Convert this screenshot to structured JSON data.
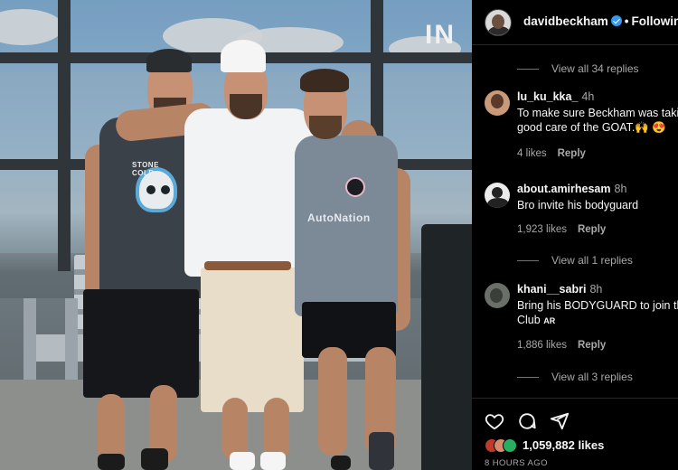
{
  "post": {
    "photo_sponsor": "AutoNation",
    "photo_shirt_text": "STONE COLD",
    "photo_building_text": "IN"
  },
  "header": {
    "username": "davidbeckham",
    "separator": "•",
    "follow_label": "Following"
  },
  "comments": [
    {
      "type": "view_replies",
      "label": "View all 34 replies"
    },
    {
      "type": "comment",
      "user": "lu_ku_kka_",
      "time": "4h",
      "text_line1": "To make sure Beckham was takin",
      "text_line2": "good care of the GOAT.🙌 😍",
      "likes": "4 likes",
      "reply": "Reply"
    },
    {
      "type": "comment",
      "user": "about.amirhesam",
      "time": "8h",
      "text_line1": "Bro invite his bodyguard",
      "likes": "1,923 likes",
      "reply": "Reply"
    },
    {
      "type": "view_replies",
      "label": "View all 1 replies"
    },
    {
      "type": "comment",
      "user": "khani__sabri",
      "time": "8h",
      "text_line1": "Bring his BODYGUARD to join the",
      "text_line2": "Club",
      "tag": "AR",
      "likes": "1,886 likes",
      "reply": "Reply"
    },
    {
      "type": "view_replies",
      "label": "View all 3 replies"
    }
  ],
  "actions": {
    "icons": [
      "heart-icon",
      "comment-icon",
      "share-icon"
    ],
    "likes": "1,059,882 likes",
    "timestamp": "8 HOURS AGO"
  },
  "colors": {
    "verified": "#3897f0",
    "secondary_text": "#a8a8a8",
    "background": "#000000"
  }
}
